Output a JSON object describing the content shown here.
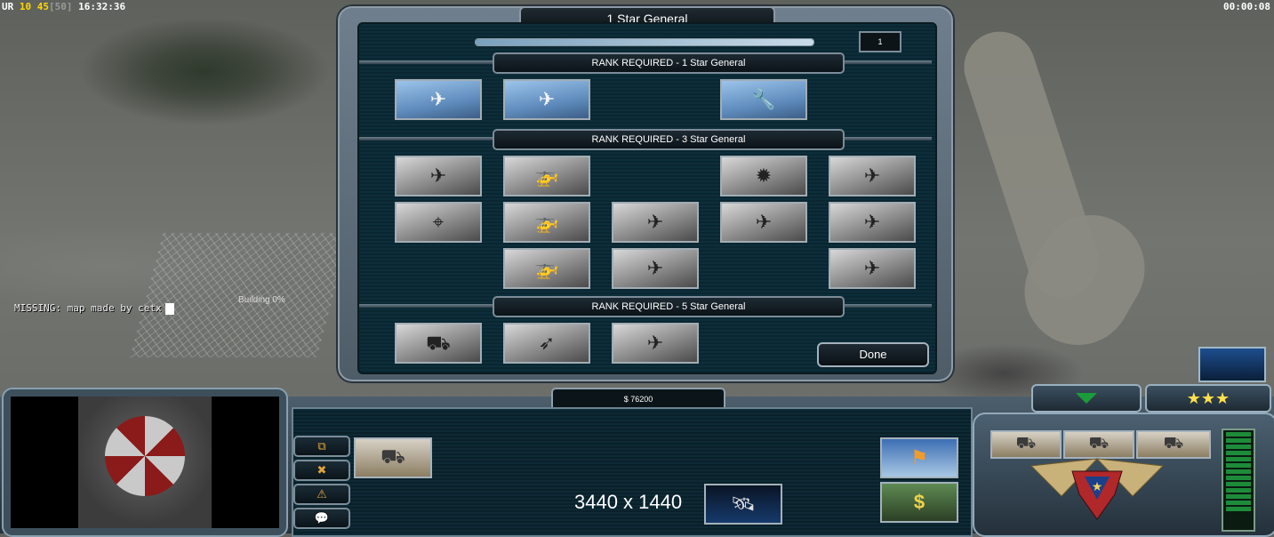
{
  "hud": {
    "stat_a": "UR",
    "stat_b": "10",
    "stat_c": "45",
    "stat_d": "[50]",
    "clock": "16:32:36",
    "game_timer": "00:00:08",
    "missing_text": "MISSING: map made by cetx",
    "building_text": "Building 0%"
  },
  "dialog": {
    "title": "1 Star General",
    "points": "1",
    "progress_fraction": 1.0,
    "done_label": "Done",
    "sections": [
      {
        "label": "RANK REQUIRED - 1 Star General",
        "tiles": [
          {
            "name": "spy-drone-upgrade",
            "style": "color",
            "glyph": "✈"
          },
          {
            "name": "jet-aircraft-upgrade",
            "style": "color",
            "glyph": "✈"
          },
          {
            "name": "field-repair-upgrade",
            "style": "color",
            "glyph": "🔧"
          }
        ]
      },
      {
        "label": "RANK REQUIRED - 3 Star General",
        "tiles": [
          {
            "name": "paradrop-upgrade",
            "style": "grey",
            "glyph": "✈"
          },
          {
            "name": "helicopter-upgrade-1",
            "style": "grey",
            "glyph": "🚁"
          },
          {
            "name": "napalm-strike-upgrade",
            "style": "grey",
            "glyph": "✹"
          },
          {
            "name": "strafing-jet-upgrade",
            "style": "grey",
            "glyph": "✈"
          },
          {
            "name": "sniper-upgrade",
            "style": "grey",
            "glyph": "⌖"
          },
          {
            "name": "helicopter-upgrade-2",
            "style": "grey",
            "glyph": "🚁"
          },
          {
            "name": "stealth-bomber-upgrade-1",
            "style": "grey",
            "glyph": "✈"
          },
          {
            "name": "missile-strike-upgrade",
            "style": "grey",
            "glyph": "✈"
          },
          {
            "name": "fighter-squadron-upgrade",
            "style": "grey",
            "glyph": "✈"
          },
          {
            "name": "helicopter-upgrade-3",
            "style": "grey",
            "glyph": "🚁"
          },
          {
            "name": "stealth-bomber-upgrade-2",
            "style": "grey",
            "glyph": "✈"
          },
          {
            "name": "bomber-squadron-upgrade",
            "style": "grey",
            "glyph": "✈"
          }
        ]
      },
      {
        "label": "RANK REQUIRED - 5 Star General",
        "tiles": [
          {
            "name": "supply-drop-upgrade",
            "style": "grey",
            "glyph": "⛟"
          },
          {
            "name": "cruise-missile-upgrade",
            "style": "grey",
            "glyph": "➶"
          },
          {
            "name": "bomber-upgrade",
            "style": "grey",
            "glyph": "✈"
          }
        ]
      }
    ]
  },
  "control_bar": {
    "money": "$ 76200",
    "resolution_label": "3440 x 1440",
    "stars": "★★★",
    "side_buttons": [
      "⧉",
      "✖",
      "⚠",
      "💬"
    ],
    "dollar_glyph": "$",
    "colors": {
      "panel": "#0d2a35",
      "frame": "#6d8492",
      "energy": "#1d8c3a",
      "stars": "#ffe04a"
    }
  }
}
